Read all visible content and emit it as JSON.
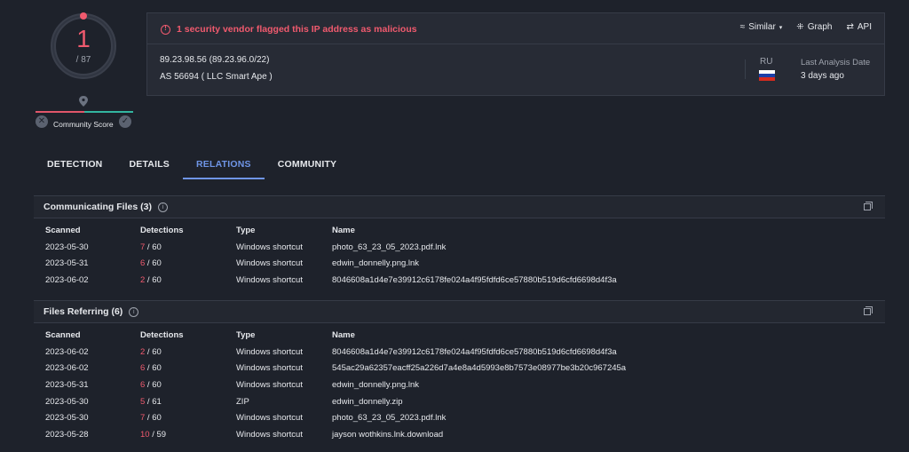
{
  "score": {
    "positives": "1",
    "total": "/ 87"
  },
  "community": {
    "label": "Community Score"
  },
  "alert": "1 security vendor flagged this IP address as malicious",
  "actions": {
    "similar": "Similar",
    "graph": "Graph",
    "api": "API"
  },
  "ip": {
    "address": "89.23.98.56",
    "range": "(89.23.96.0/22)",
    "as": "AS 56694",
    "owner": "( LLC Smart Ape )"
  },
  "country": {
    "code": "RU",
    "flag_colors": [
      "#ffffff",
      "#1c3fa8",
      "#d52b1e"
    ]
  },
  "analysis": {
    "label": "Last Analysis Date",
    "value": "3 days ago"
  },
  "tabs": [
    "DETECTION",
    "DETAILS",
    "RELATIONS",
    "COMMUNITY"
  ],
  "active_tab": "RELATIONS",
  "columns": [
    "Scanned",
    "Detections",
    "Type",
    "Name"
  ],
  "communicating_files": {
    "title": "Communicating Files",
    "count": "(3)",
    "rows": [
      {
        "scanned": "2023-05-30",
        "det": "7",
        "total": "60",
        "type": "Windows shortcut",
        "name": "photo_63_23_05_2023.pdf.lnk"
      },
      {
        "scanned": "2023-05-31",
        "det": "6",
        "total": "60",
        "type": "Windows shortcut",
        "name": "edwin_donnelly.png.lnk"
      },
      {
        "scanned": "2023-06-02",
        "det": "2",
        "total": "60",
        "type": "Windows shortcut",
        "name": "8046608a1d4e7e39912c6178fe024a4f95fdfd6ce57880b519d6cfd6698d4f3a"
      }
    ]
  },
  "files_referring": {
    "title": "Files Referring",
    "count": "(6)",
    "rows": [
      {
        "scanned": "2023-06-02",
        "det": "2",
        "total": "60",
        "type": "Windows shortcut",
        "name": "8046608a1d4e7e39912c6178fe024a4f95fdfd6ce57880b519d6cfd6698d4f3a"
      },
      {
        "scanned": "2023-06-02",
        "det": "6",
        "total": "60",
        "type": "Windows shortcut",
        "name": "545ac29a62357eacff25a226d7a4e8a4d5993e8b7573e08977be3b20c967245a"
      },
      {
        "scanned": "2023-05-31",
        "det": "6",
        "total": "60",
        "type": "Windows shortcut",
        "name": "edwin_donnelly.png.lnk"
      },
      {
        "scanned": "2023-05-30",
        "det": "5",
        "total": "61",
        "type": "ZIP",
        "name": "edwin_donnelly.zip"
      },
      {
        "scanned": "2023-05-30",
        "det": "7",
        "total": "60",
        "type": "Windows shortcut",
        "name": "photo_63_23_05_2023.pdf.lnk"
      },
      {
        "scanned": "2023-05-28",
        "det": "10",
        "total": "59",
        "type": "Windows shortcut",
        "name": "jayson wothkins.lnk.download"
      }
    ]
  }
}
